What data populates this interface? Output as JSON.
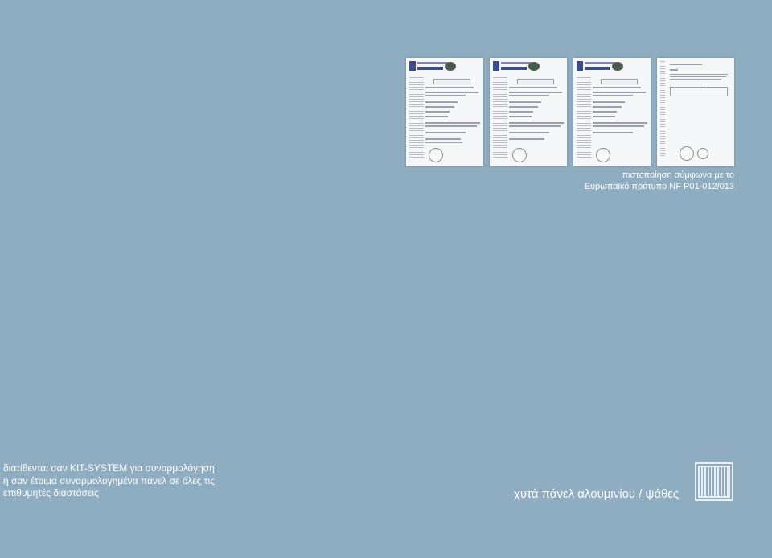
{
  "certificates": {
    "count": 4,
    "stamp_icon": "certificate-stamp-icon",
    "brand_color": "#3e4c8c"
  },
  "certification_caption": {
    "line1": "πιστοποίηση σύμφωνα με το",
    "line2": "Ευρωπαϊκό πρότυπο NF P01-012/013"
  },
  "availability_text": {
    "line1": "διατίθενται σαν KIT-SYSTEM για συναρμολόγηση",
    "line2": "ή σαν έτοιμα συναρμολογημένα πάνελ σε όλες τις",
    "line3": "επιθυμητές διαστάσεις"
  },
  "product": {
    "title": "χυτά πάνελ αλουμινίου / ψάθες",
    "icon": "fence-panel-icon"
  },
  "colors": {
    "background": "#8fadc0",
    "text": "#ffffff"
  }
}
